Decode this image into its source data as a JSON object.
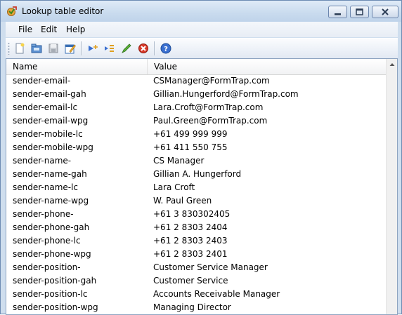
{
  "window": {
    "title": "Lookup table editor"
  },
  "menu": {
    "file": "File",
    "edit": "Edit",
    "help": "Help"
  },
  "toolbar": {
    "icons": [
      "new-file-icon",
      "open-folder-icon",
      "save-icon",
      "edit-properties-icon",
      "add-row-icon",
      "insert-row-icon",
      "edit-pencil-icon",
      "delete-icon",
      "help-icon"
    ]
  },
  "grid": {
    "columns": [
      "Name",
      "Value"
    ],
    "rows": [
      [
        "sender-email-",
        "CSManager@FormTrap.com"
      ],
      [
        "sender-email-gah",
        "Gillian.Hungerford@FormTrap.com"
      ],
      [
        "sender-email-lc",
        "Lara.Croft@FormTrap.com"
      ],
      [
        "sender-email-wpg",
        "Paul.Green@FormTrap.com"
      ],
      [
        "sender-mobile-lc",
        "+61 499 999 999"
      ],
      [
        "sender-mobile-wpg",
        "+61 411 550 755"
      ],
      [
        "sender-name-",
        "CS Manager"
      ],
      [
        "sender-name-gah",
        "Gillian A. Hungerford"
      ],
      [
        "sender-name-lc",
        "Lara Croft"
      ],
      [
        "sender-name-wpg",
        "W. Paul Green"
      ],
      [
        "sender-phone-",
        "+61 3 830302405"
      ],
      [
        "sender-phone-gah",
        "+61 2 8303 2404"
      ],
      [
        "sender-phone-lc",
        "+61 2 8303 2403"
      ],
      [
        "sender-phone-wpg",
        "+61 2 8303 2401"
      ],
      [
        "sender-position-",
        "Customer Service Manager"
      ],
      [
        "sender-position-gah",
        "Customer Service"
      ],
      [
        "sender-position-lc",
        "Accounts Receivable Manager"
      ],
      [
        "sender-position-wpg",
        "Managing Director"
      ]
    ]
  }
}
